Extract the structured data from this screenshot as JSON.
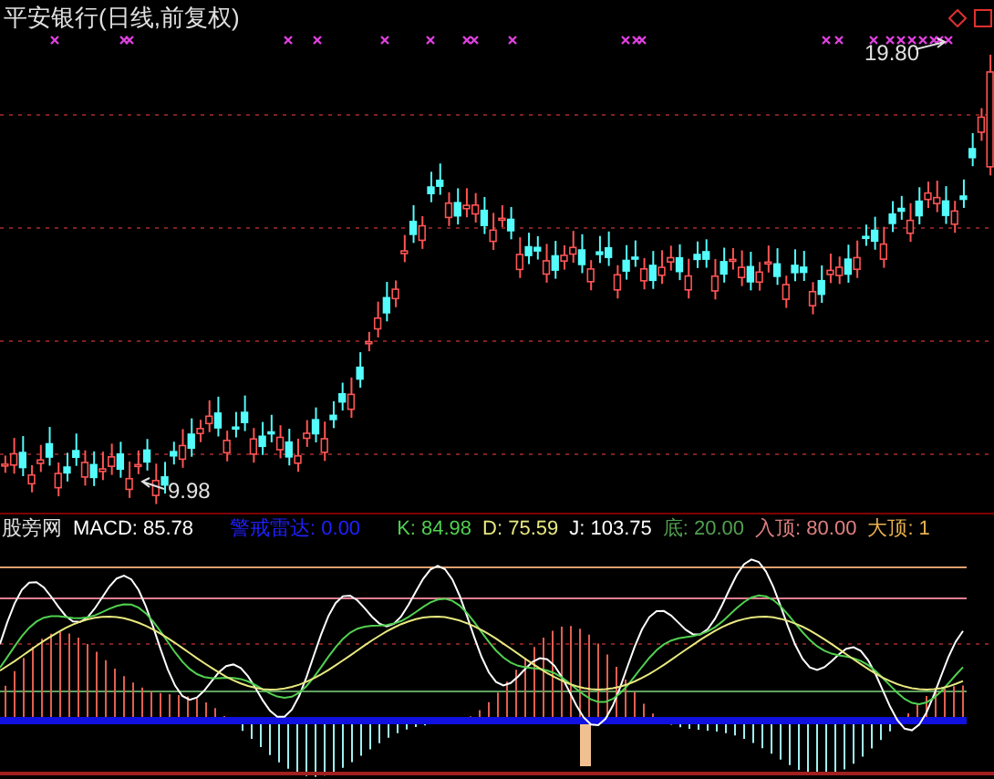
{
  "chart": {
    "title": "平安银行(日线,前复权)",
    "high_label": "19.80",
    "low_label": "9.98"
  },
  "indicator": {
    "name": "股旁网",
    "values": [
      {
        "label": "MACD: 85.78",
        "color": "#ffffff"
      },
      {
        "label": "警戒雷达: 0.00",
        "color": "#2020ff"
      },
      {
        "label": "K: 84.98",
        "color": "#50d050"
      },
      {
        "label": "D: 75.59",
        "color": "#e8e880"
      },
      {
        "label": "J: 103.75",
        "color": "#ffffff"
      },
      {
        "label": "底: 20.00",
        "color": "#50a050"
      },
      {
        "label": "入顶: 80.00",
        "color": "#e08080"
      },
      {
        "label": "大顶: 1",
        "color": "#e8b050"
      }
    ]
  }
}
